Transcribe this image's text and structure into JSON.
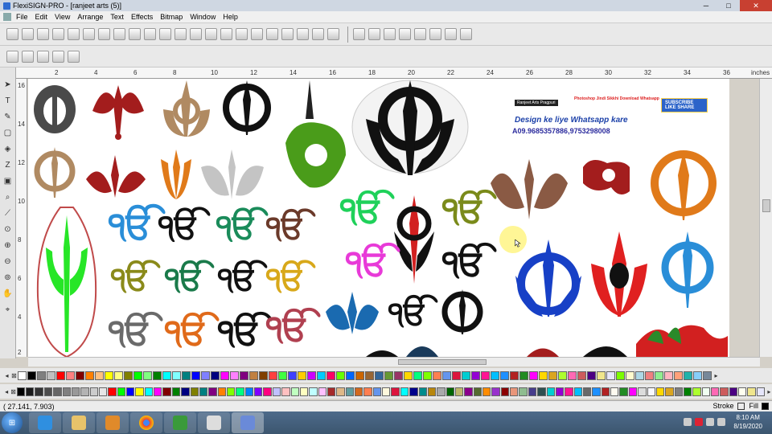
{
  "window": {
    "title": "FlexiSIGN-PRO - [ranjeet arts  (5)]"
  },
  "menu": [
    "File",
    "Edit",
    "View",
    "Arrange",
    "Text",
    "Effects",
    "Bitmap",
    "Window",
    "Help"
  ],
  "ruler": {
    "units": "inches",
    "h_ticks": [
      "2",
      "4",
      "6",
      "8",
      "10",
      "12",
      "14",
      "16",
      "18",
      "20",
      "22",
      "24",
      "26",
      "28",
      "30",
      "32",
      "34",
      "36"
    ],
    "v_ticks": [
      "16",
      "14",
      "12",
      "10",
      "8",
      "6",
      "4",
      "2"
    ]
  },
  "banner": {
    "channel": "Ranjeet Arts Pragpuri",
    "red_note": "Photoshop Jindi Sikkhi Download Whatsapp",
    "subscribe": "SUBSCRIBE LIKE SHARE",
    "headline": "Design ke liye Whatsapp kare",
    "phones": "A09.9685357886,9753298008"
  },
  "status": {
    "coords": "( 27.141,    7.903)",
    "stroke_label": "Stroke",
    "fill_label": "Fill"
  },
  "clock": {
    "time": "8:10 AM",
    "date": "8/19/2020"
  },
  "colors": {
    "palette_row1": [
      "#ffffff",
      "#000000",
      "#808080",
      "#c0c0c0",
      "#ff0000",
      "#ff8080",
      "#800000",
      "#ff8000",
      "#ffc080",
      "#ffff00",
      "#ffff80",
      "#808000",
      "#00ff00",
      "#80ff80",
      "#008000",
      "#00ffff",
      "#80ffff",
      "#008080",
      "#0000ff",
      "#8080ff",
      "#000080",
      "#ff00ff",
      "#ff80ff",
      "#800080",
      "#c08040",
      "#804000",
      "#ff4040",
      "#40ff40",
      "#4040ff",
      "#ffcc00",
      "#cc00ff",
      "#00ccff",
      "#ff0066",
      "#66ff00",
      "#0066ff",
      "#cc6600",
      "#996633",
      "#336699",
      "#669933",
      "#993366",
      "#ffd700",
      "#00ff7f",
      "#7fff00",
      "#ff7f50",
      "#6495ed",
      "#dc143c",
      "#00ced1",
      "#9400d3",
      "#ff1493",
      "#00bfff",
      "#1e90ff",
      "#b22222",
      "#228b22",
      "#ff00ff",
      "#ffd700",
      "#daa520",
      "#adff2f",
      "#ff69b4",
      "#cd5c5c",
      "#4b0082",
      "#f0e68c",
      "#e6e6fa",
      "#7cfc00",
      "#fffacd",
      "#add8e6",
      "#f08080",
      "#90ee90",
      "#ffb6c1",
      "#ffa07a",
      "#20b2aa",
      "#87cefa",
      "#778899"
    ],
    "palette_row2": [
      "#000000",
      "#1a1a1a",
      "#333333",
      "#4d4d4d",
      "#666666",
      "#808080",
      "#999999",
      "#b3b3b3",
      "#cccccc",
      "#e6e6e6",
      "#ff0000",
      "#00ff00",
      "#0000ff",
      "#ffff00",
      "#00ffff",
      "#ff00ff",
      "#800000",
      "#008000",
      "#000080",
      "#808000",
      "#008080",
      "#800080",
      "#ff8000",
      "#80ff00",
      "#00ff80",
      "#0080ff",
      "#8000ff",
      "#ff0080",
      "#c0c0ff",
      "#ffc0c0",
      "#c0ffc0",
      "#ffffc0",
      "#c0ffff",
      "#ffc0ff",
      "#a52a2a",
      "#deb887",
      "#5f9ea0",
      "#d2691e",
      "#ff7f50",
      "#6495ed",
      "#fff8dc",
      "#dc143c",
      "#00ffff",
      "#00008b",
      "#008b8b",
      "#b8860b",
      "#a9a9a9",
      "#006400",
      "#bdb76b",
      "#8b008b",
      "#556b2f",
      "#ff8c00",
      "#9932cc",
      "#8b0000",
      "#e9967a",
      "#8fbc8f",
      "#483d8b",
      "#2f4f4f",
      "#00ced1",
      "#9400d3",
      "#ff1493",
      "#00bfff",
      "#696969",
      "#1e90ff",
      "#b22222",
      "#fffaf0",
      "#228b22",
      "#ff00ff",
      "#dcdcdc",
      "#f8f8ff",
      "#ffd700",
      "#daa520",
      "#808080",
      "#008000",
      "#adff2f",
      "#f0fff0",
      "#ff69b4",
      "#cd5c5c",
      "#4b0082",
      "#fffff0",
      "#f0e68c",
      "#e6e6fa"
    ]
  },
  "toolbox_icons": [
    "pointer-icon",
    "text-icon",
    "node-edit-icon",
    "shape-icon",
    "fill-icon",
    "contour-icon",
    "bitmap-icon",
    "knife-icon",
    "eyedropper-icon",
    "zoom-icon",
    "zoom-in-icon",
    "zoom-out-icon",
    "zoom-fit-icon",
    "pan-icon",
    "zoom-page-icon"
  ],
  "artwork": [
    {
      "name": "khanda-ornate-gray",
      "color": "#4a4a4a"
    },
    {
      "name": "khanda-red-floral",
      "color": "#a31d1d"
    },
    {
      "name": "khanda-tan",
      "color": "#b08a62"
    },
    {
      "name": "khanda-black",
      "color": "#111111"
    },
    {
      "name": "khanda-green-lion",
      "color": "#4a9c1a"
    },
    {
      "name": "khanda-black-large",
      "color": "#111111"
    },
    {
      "name": "khanda-orange",
      "color": "#e07a1a"
    },
    {
      "name": "khanda-blue",
      "color": "#1740c6"
    },
    {
      "name": "khanda-red",
      "color": "#e02020"
    },
    {
      "name": "khanda-skyblue",
      "color": "#2a8ed8"
    },
    {
      "name": "ik-onkar-green",
      "color": "#1fd15a"
    },
    {
      "name": "ik-onkar-magenta",
      "color": "#e83ad8"
    },
    {
      "name": "trishul-green",
      "color": "#27e627"
    }
  ]
}
